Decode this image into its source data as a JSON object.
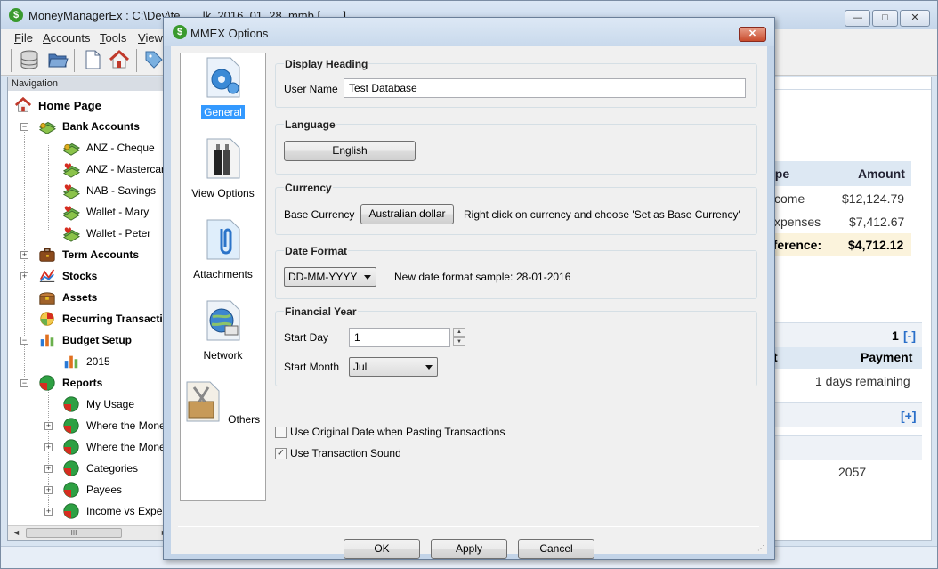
{
  "main_window": {
    "title": "MoneyManagerEx : C:\\Dev\\te...  ...lk_2016_01_28_mmb [...  ...]",
    "app_icon": "$",
    "min_label": "—",
    "max_label": "□",
    "close_label": "✕"
  },
  "menu": [
    {
      "first": "F",
      "rest": "ile"
    },
    {
      "first": "A",
      "rest": "ccounts"
    },
    {
      "first": "T",
      "rest": "ools"
    },
    {
      "first": "V",
      "rest": "iew"
    }
  ],
  "toolbar": {
    "icons": [
      "database-icon",
      "open-folder-icon",
      "new-document-icon",
      "home-icon",
      "tag-icon"
    ]
  },
  "navigation": {
    "header": "Navigation",
    "items": [
      {
        "label": "Home Page",
        "icon": "home-icon"
      },
      {
        "label": "Bank Accounts",
        "icon": "money-icon"
      },
      {
        "label": "ANZ - Cheque",
        "icon": "money-icon"
      },
      {
        "label": "ANZ - Mastercard",
        "icon": "money-heart-icon"
      },
      {
        "label": "NAB - Savings",
        "icon": "money-heart-icon"
      },
      {
        "label": "Wallet - Mary",
        "icon": "money-heart-icon"
      },
      {
        "label": "Wallet - Peter",
        "icon": "money-heart-icon"
      },
      {
        "label": "Term Accounts",
        "icon": "briefcase-icon"
      },
      {
        "label": "Stocks",
        "icon": "chart-line-icon"
      },
      {
        "label": "Assets",
        "icon": "treasure-icon"
      },
      {
        "label": "Recurring Transactions",
        "icon": "recurring-icon"
      },
      {
        "label": "Budget Setup",
        "icon": "bar-chart-icon"
      },
      {
        "label": "2015",
        "icon": "bar-chart-icon"
      },
      {
        "label": "Reports",
        "icon": "pie-chart-icon"
      },
      {
        "label": "My Usage",
        "icon": "pie-chart-icon"
      },
      {
        "label": "Where the Money Goes",
        "icon": "pie-chart-icon"
      },
      {
        "label": "Where the Money Comes From",
        "icon": "pie-chart-icon"
      },
      {
        "label": "Categories",
        "icon": "pie-chart-icon"
      },
      {
        "label": "Payees",
        "icon": "pie-chart-icon"
      },
      {
        "label": "Income vs Expenses",
        "icon": "pie-chart-icon"
      }
    ],
    "scroll_thumb": "III",
    "scroll_left": "◄",
    "scroll_right": "►"
  },
  "home_panel": {
    "col_type": "ype",
    "col_amount": "Amount",
    "rows": [
      {
        "type": "come",
        "amount": "$12,124.79"
      },
      {
        "type": "xpenses",
        "amount": "$7,412.67"
      }
    ],
    "diff_label": "fference:",
    "diff_value": "$4,712.12",
    "count": "1",
    "collapse": "[-]",
    "col_t": "t",
    "col_payment": "Payment",
    "remaining": "1 days remaining",
    "expand": "[+]",
    "number": "2057"
  },
  "dialog": {
    "title": "MMEX Options",
    "close": "✕",
    "pages": [
      {
        "label": "General",
        "icon": "gear-icon",
        "selected": true
      },
      {
        "label": "View Options",
        "icon": "view-options-icon",
        "selected": false
      },
      {
        "label": "Attachments",
        "icon": "attachment-icon",
        "selected": false
      },
      {
        "label": "Network",
        "icon": "network-icon",
        "selected": false
      },
      {
        "label": "Others",
        "icon": "tools-icon",
        "selected": false
      }
    ],
    "display_heading": {
      "title": "Display Heading",
      "user_name_label": "User Name",
      "user_name_value": "Test Database"
    },
    "language": {
      "title": "Language",
      "button": "English"
    },
    "currency": {
      "title": "Currency",
      "base_label": "Base Currency",
      "button": "Australian dollar",
      "hint": "Right click on currency and choose 'Set as Base Currency'"
    },
    "date_format": {
      "title": "Date Format",
      "selected": "DD-MM-YYYY",
      "sample_label": "New date format sample:",
      "sample_value": "28-01-2016"
    },
    "financial_year": {
      "title": "Financial Year",
      "start_day_label": "Start Day",
      "start_day_value": "1",
      "start_month_label": "Start Month",
      "start_month_value": "Jul"
    },
    "checkboxes": [
      {
        "label": "Use Original Date when Pasting Transactions",
        "checked": false
      },
      {
        "label": "Use Transaction Sound",
        "checked": true
      }
    ],
    "buttons": {
      "ok": "OK",
      "apply": "Apply",
      "cancel": "Cancel"
    }
  }
}
